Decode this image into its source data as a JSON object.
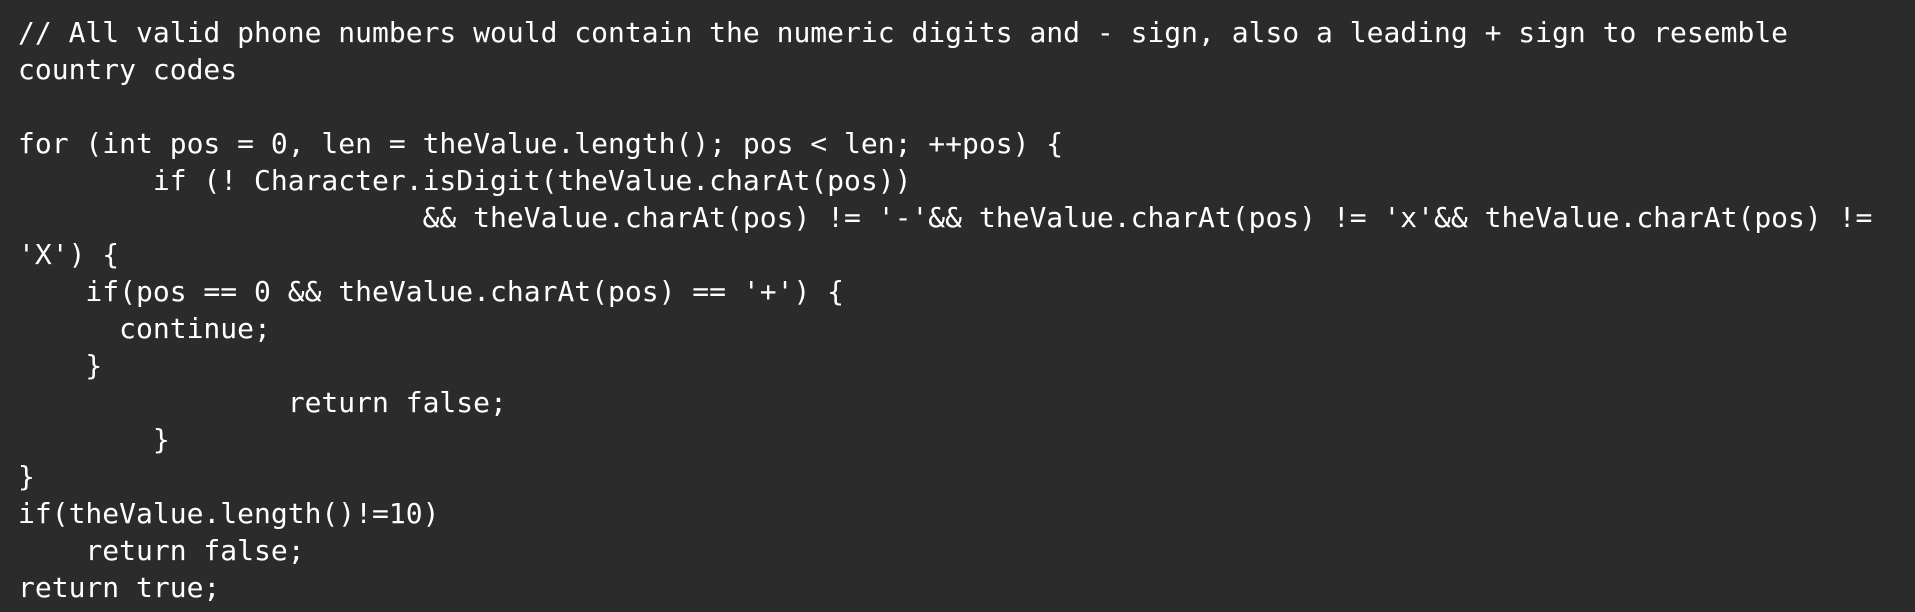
{
  "code": {
    "lines": [
      "// All valid phone numbers would contain the numeric digits and - sign, also a leading + sign to resemble",
      "country codes",
      "",
      "for (int pos = 0, len = theValue.length(); pos < len; ++pos) {",
      "        if (! Character.isDigit(theValue.charAt(pos))",
      "                        && theValue.charAt(pos) != '-'&& theValue.charAt(pos) != 'x'&& theValue.charAt(pos) !=",
      "'X') {",
      "    if(pos == 0 && theValue.charAt(pos) == '+') {",
      "      continue;",
      "    }",
      "                return false;",
      "        }",
      "}",
      "if(theValue.length()!=10)",
      "    return false;",
      "return true;"
    ]
  },
  "colors": {
    "background": "#2b2b2b",
    "text": "#ffffff"
  }
}
